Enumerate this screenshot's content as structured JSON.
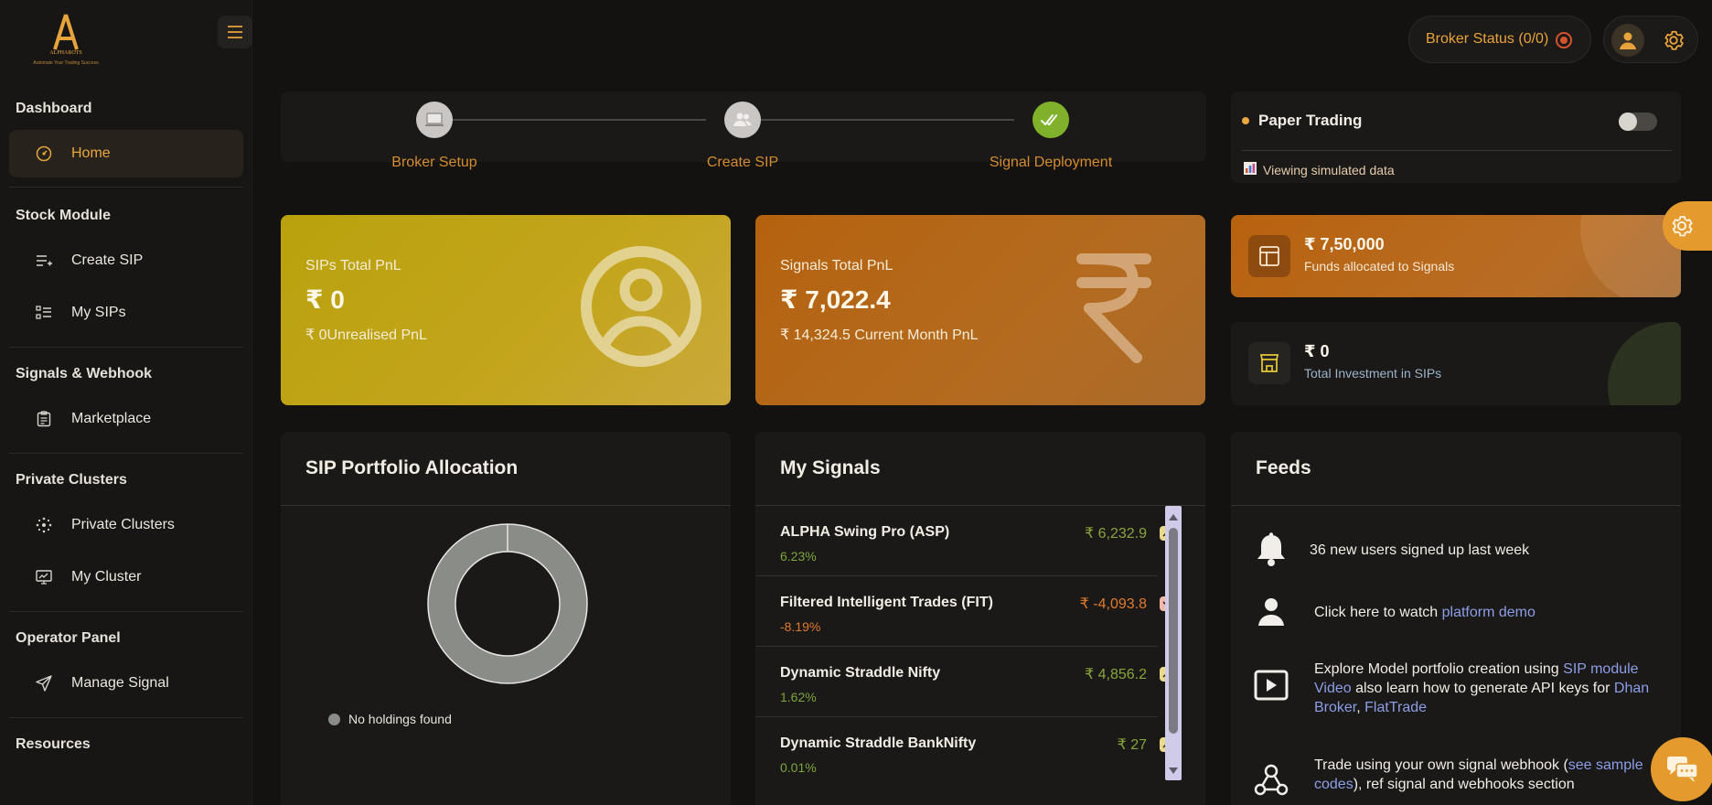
{
  "app": {
    "logo_text": "ALPHABOTS",
    "logo_tagline": "Automate Your Trading Success"
  },
  "sidebar": {
    "sections": [
      {
        "title": "Dashboard",
        "items": [
          {
            "label": "Home",
            "icon": "dashboard-gauge-icon",
            "active": true
          }
        ]
      },
      {
        "title": "Stock Module",
        "items": [
          {
            "label": "Create SIP",
            "icon": "playlist-add-icon"
          },
          {
            "label": "My SIPs",
            "icon": "list-icon"
          }
        ]
      },
      {
        "title": "Signals & Webhook",
        "items": [
          {
            "label": "Marketplace",
            "icon": "clipboard-icon"
          }
        ]
      },
      {
        "title": "Private Clusters",
        "items": [
          {
            "label": "Private Clusters",
            "icon": "cluster-icon"
          },
          {
            "label": "My Cluster",
            "icon": "monitor-icon"
          }
        ]
      },
      {
        "title": "Operator Panel",
        "items": [
          {
            "label": "Manage Signal",
            "icon": "send-icon"
          }
        ]
      },
      {
        "title": "Resources",
        "items": []
      }
    ]
  },
  "header": {
    "broker_status": "Broker Status (0/0)",
    "accent": "#e8a33a",
    "status_color": "#d6542d"
  },
  "stepper": {
    "steps": [
      {
        "label": "Broker Setup",
        "icon": "laptop-icon",
        "state": "pending"
      },
      {
        "label": "Create SIP",
        "icon": "users-icon",
        "state": "pending"
      },
      {
        "label": "Signal Deployment",
        "icon": "double-check-icon",
        "state": "done"
      }
    ]
  },
  "paper_trading": {
    "title": "Paper Trading",
    "enabled": false,
    "subtitle": "Viewing simulated data"
  },
  "pnl": {
    "sips": {
      "label": "SIPs Total PnL",
      "value": "₹ 0",
      "sub": "₹ 0Unrealised PnL"
    },
    "signals": {
      "label": "Signals Total PnL",
      "value": "₹ 7,022.4",
      "sub": "₹ 14,324.5 Current Month PnL"
    }
  },
  "funds": {
    "signals": {
      "value": "₹ 7,50,000",
      "label": "Funds allocated to Signals"
    },
    "sips": {
      "value": "₹ 0",
      "label": "Total Investment in SIPs"
    }
  },
  "portfolio": {
    "title": "SIP Portfolio Allocation",
    "legend": "No holdings found"
  },
  "signals": {
    "title": "My Signals",
    "items": [
      {
        "name": "ALPHA Swing Pro (ASP)",
        "value": "₹ 6,232.9",
        "pct": "6.23%",
        "trend": "up"
      },
      {
        "name": "Filtered Intelligent Trades (FIT)",
        "value": "₹ -4,093.8",
        "pct": "-8.19%",
        "trend": "down"
      },
      {
        "name": "Dynamic Straddle Nifty",
        "value": "₹ 4,856.2",
        "pct": "1.62%",
        "trend": "up"
      },
      {
        "name": "Dynamic Straddle BankNifty",
        "value": "₹ 27",
        "pct": "0.01%",
        "trend": "up"
      }
    ]
  },
  "feeds": {
    "title": "Feeds",
    "items": [
      {
        "icon": "bell-icon",
        "text": "36 new users signed up last week"
      },
      {
        "icon": "user-icon",
        "prefix": "Click here to watch ",
        "link": "platform demo"
      },
      {
        "icon": "play-icon",
        "prefix": "Explore Model portfolio creation using ",
        "link": "SIP module Video",
        "middle": " also learn how to generate API keys for ",
        "link2": "Dhan Broker",
        "sep": ", ",
        "link3": "FlatTrade"
      },
      {
        "icon": "webhook-icon",
        "prefix": "Trade using your own signal webhook (",
        "link": "see sample codes",
        "suffix": "), ref signal and webhooks section"
      }
    ]
  }
}
